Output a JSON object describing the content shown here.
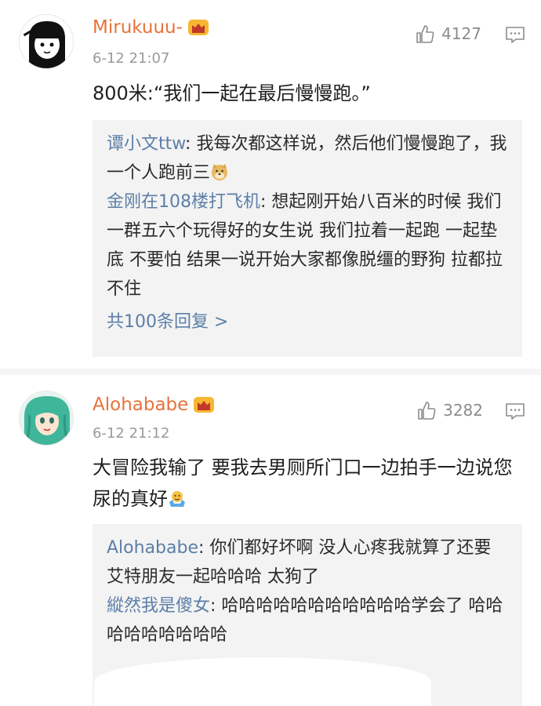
{
  "comments": [
    {
      "username": "Mirukuuu-",
      "time": "6-12 21:07",
      "likes": "4127",
      "content": "800米:“我们一起在最后慢慢跑。”",
      "replies": [
        {
          "name": "谭小文ttw",
          "text": "我每次都这样说，然后他们慢慢跑了，我一个人跑前三"
        },
        {
          "name": "金刚在108楼打飞机",
          "text": "想起刚开始八百米的时候 我们一群五六个玩得好的女生说 我们拉着一起跑 一起垫底 不要怕 结果一说开始大家都像脱缰的野狗 拉都拉不住"
        }
      ],
      "more_replies": "共100条回复 >"
    },
    {
      "username": "Alohababe",
      "time": "6-12 21:12",
      "likes": "3282",
      "content": "大冒险我输了 要我去男厕所门口一边拍手一边说您尿的真好",
      "replies": [
        {
          "name": "Alohababe",
          "text": "你们都好坏啊 没人心疼我就算了还要艾特朋友一起哈哈哈 太狗了"
        },
        {
          "name": "縱然我是傻女",
          "text": "哈哈哈哈哈哈哈哈哈哈哈学会了 哈哈哈哈哈哈哈哈哈"
        }
      ]
    }
  ],
  "colors": {
    "username": "#e8733a",
    "reply_name": "#5c7fa8",
    "reply_bg": "#f3f3f3",
    "meta_gray": "#9a9a9a"
  },
  "icons": [
    "crown-icon",
    "thumbs-up-icon",
    "comment-icon",
    "doge-emoji",
    "shrug-emoji"
  ]
}
